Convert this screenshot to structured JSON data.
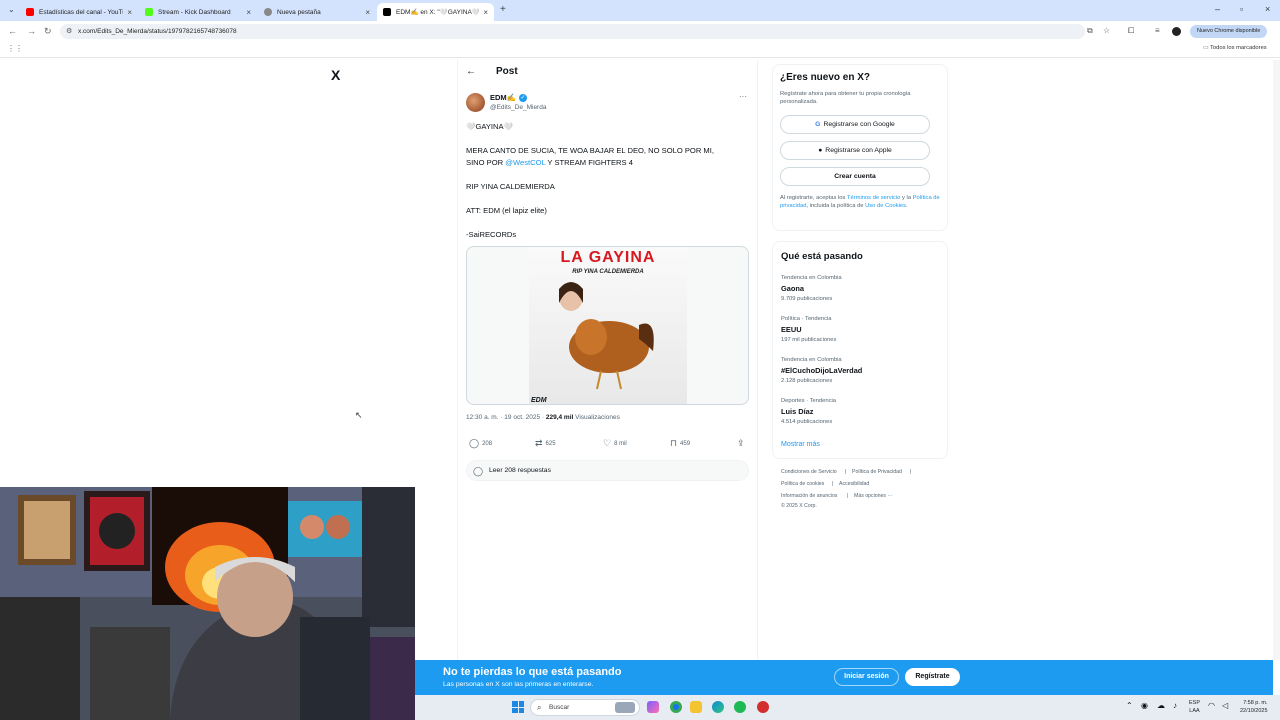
{
  "browser": {
    "tabs": [
      {
        "title": "Estadísticas del canal - YouTube",
        "fav_color": "#ff0000"
      },
      {
        "title": "Stream - Kick Dashboard",
        "fav_color": "#53fc18"
      },
      {
        "title": "Nueva pestaña",
        "fav_color": "#888888"
      },
      {
        "title": "EDM✍️ en X: \"🤍GAYINA🤍 |",
        "fav_color": "#000000"
      }
    ],
    "new_tab": "+",
    "url": "x.com/Edits_De_Mierda/status/1979782165748736078",
    "update_chip": "Nuevo Chrome disponible",
    "bookmarks_all": "Todos los marcadores"
  },
  "x": {
    "logo": "X",
    "post_header": {
      "back": "←",
      "title": "Post"
    },
    "author": {
      "name": "EDM✍️",
      "handle": "@Edits_De_Mierda",
      "verified": "✓"
    },
    "more": "···",
    "text": {
      "line1": "🤍GAYINA🤍",
      "line2": "MERA CANTO DE SUCIA, TE WOA BAJAR EL DEO, NO SOLO POR MI,",
      "line3_pre": "SINO POR ",
      "line3_mention": "@WestCOL",
      "line3_post": "  Y STREAM FIGHTERS 4",
      "line4": "RIP YINA CALDEMIERDA",
      "line5": "ATT: EDM (el lapiz elite)",
      "line6": "-SaiRECORDs"
    },
    "media": {
      "poster_title": "LA GAYINA",
      "poster_subtitle": "RIP YINA CALDEMIERDA",
      "poster_sign": "EDM"
    },
    "meta": {
      "time": "12:30 a. m. · 19 oct. 2025 · ",
      "views": "229,4 mil",
      "views_label": " Visualizaciones"
    },
    "actions": {
      "replies": "208",
      "reposts": "625",
      "likes": "8 mil",
      "bookmarks": "459"
    },
    "read_replies": "Leer 208 respuestas"
  },
  "sidebar": {
    "signup": {
      "title": "¿Eres nuevo en X?",
      "subtitle": "Regístrate ahora para obtener tu propia cronología personalizada.",
      "google": "Registrarse con Google",
      "apple": "Registrarse con Apple",
      "create": "Crear cuenta",
      "legal_1": "Al registrarte, aceptas los ",
      "legal_terms": "Términos de servicio",
      "legal_2": " y la ",
      "legal_privacy": "Política de privacidad",
      "legal_3": ", incluida la política de ",
      "legal_cookies": "Uso de Cookies",
      "legal_4": "."
    },
    "trends": {
      "title": "Qué está pasando",
      "items": [
        {
          "category": "Tendencia en Colombia",
          "name": "Gaona",
          "count": "9.709 publicaciones"
        },
        {
          "category": "Política · Tendencia",
          "name": "EEUU",
          "count": "197 mil publicaciones"
        },
        {
          "category": "Tendencia en Colombia",
          "name": "#ElCuchoDijoLaVerdad",
          "count": "2.128 publicaciones"
        },
        {
          "category": "Deportes · Tendencia",
          "name": "Luis Díaz",
          "count": "4.514 publicaciones"
        }
      ],
      "show_more": "Mostrar más"
    },
    "footer": {
      "terms": "Condiciones de Servicio",
      "privacy": "Política de Privacidad",
      "cookies": "Política de cookies",
      "accessibility": "Accesibilidad",
      "ads": "Información de anuncios",
      "more": "Más opciones ···",
      "copyright": "© 2025 X Corp."
    }
  },
  "banner": {
    "title": "No te pierdas lo que está pasando",
    "subtitle": "Las personas en X son las primeras en enterarse.",
    "login": "Iniciar sesión",
    "register": "Regístrate"
  },
  "taskbar": {
    "search": "Buscar",
    "lang_1": "ESP",
    "lang_2": "LAA",
    "time": "7:58 p. m.",
    "date": "22/10/2025"
  }
}
